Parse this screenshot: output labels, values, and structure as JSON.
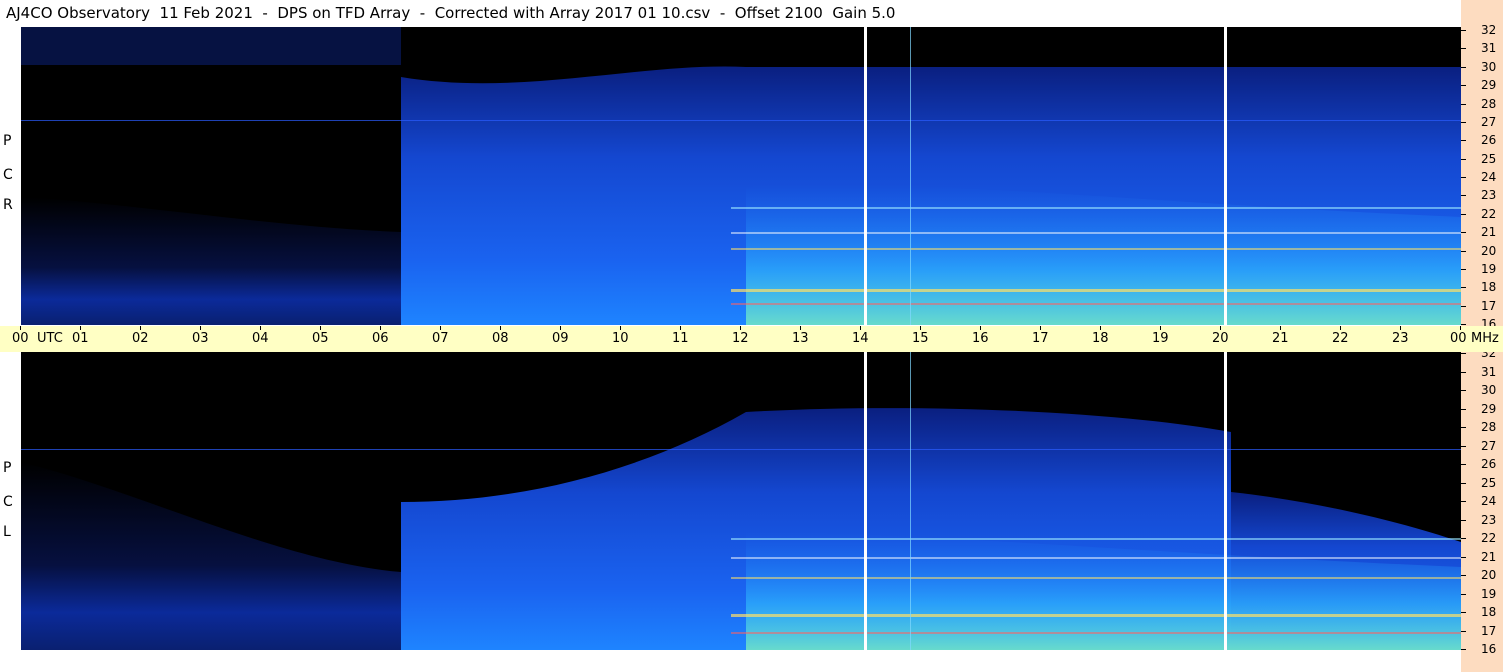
{
  "title": "AJ4CO Observatory  11 Feb 2021  -  DPS on TFD Array  -  Corrected with Array 2017 01 10.csv  -  Offset 2100  Gain 5.0",
  "panels": {
    "top": {
      "pol_letters": [
        "R",
        "C",
        "P"
      ]
    },
    "bottom": {
      "pol_letters": [
        "L",
        "C",
        "P"
      ]
    }
  },
  "colors": {
    "background_dark": "#000000",
    "time_axis_bg": "#ffffc4",
    "freq_axis_bg": "#fddcc0",
    "spectrum_blue": "#1a4fe0",
    "spectrum_cyan": "#33c8ff",
    "spectrum_yellow": "#ffe066"
  },
  "chart_data": {
    "type": "heatmap",
    "x_axis": {
      "unit_label": "UTC",
      "range": [
        0,
        24
      ],
      "tick_labels": [
        "00",
        "01",
        "02",
        "03",
        "04",
        "05",
        "06",
        "07",
        "08",
        "09",
        "10",
        "11",
        "12",
        "13",
        "14",
        "15",
        "16",
        "17",
        "18",
        "19",
        "20",
        "21",
        "22",
        "23",
        "00"
      ]
    },
    "y_axis": {
      "unit_label": "MHz",
      "range": [
        16,
        32
      ],
      "tick_labels": [
        "32",
        "31",
        "30",
        "29",
        "28",
        "27",
        "26",
        "25",
        "24",
        "23",
        "22",
        "21",
        "20",
        "19",
        "18",
        "17",
        "16"
      ]
    },
    "panels": [
      "RCP",
      "LCP"
    ],
    "noise_dropout_end_utc": 6.4,
    "daylight_window_utc": [
      12.2,
      24
    ],
    "interference_lines_utc": [
      14.1,
      14.85,
      20.1
    ],
    "interference_bands_mhz": [
      27,
      22,
      21,
      20,
      18,
      17
    ]
  }
}
